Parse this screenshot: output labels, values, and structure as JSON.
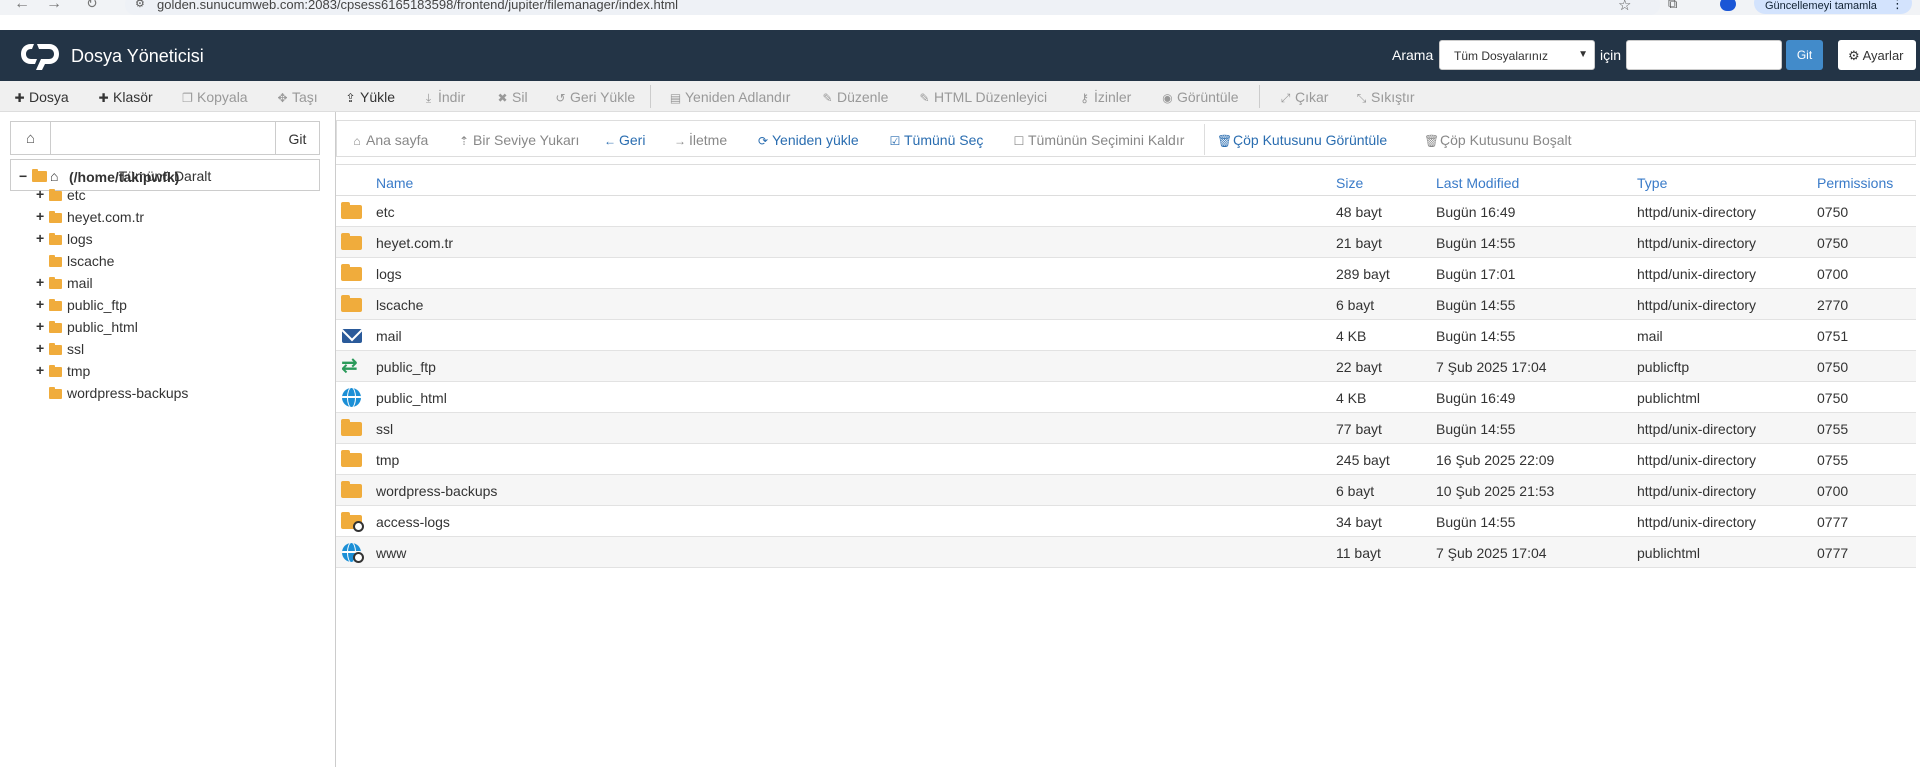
{
  "browser": {
    "url": "golden.sunucumweb.com:2083/cpsess6165183598/frontend/jupiter/filemanager/index.html",
    "update_label": "Güncellemeyi tamamla"
  },
  "header": {
    "app_title": "Dosya Yöneticisi",
    "search_label": "Arama",
    "search_scope": "Tüm Dosyalarınız",
    "icin_label": "için",
    "search_value": "",
    "go_label": "Git",
    "settings_label": "Ayarlar"
  },
  "toolbar": {
    "items": [
      {
        "label": "Dosya",
        "icon": "plus-icon",
        "glyph": "✚",
        "enabled": true
      },
      {
        "label": "Klasör",
        "icon": "plus-icon",
        "glyph": "✚",
        "enabled": true
      },
      {
        "label": "Kopyala",
        "icon": "copy-icon",
        "glyph": "❐",
        "enabled": false
      },
      {
        "label": "Taşı",
        "icon": "move-icon",
        "glyph": "✥",
        "enabled": false
      },
      {
        "label": "Yükle",
        "icon": "upload-icon",
        "glyph": "⇪",
        "enabled": true
      },
      {
        "label": "İndir",
        "icon": "download-icon",
        "glyph": "⤓",
        "enabled": false
      },
      {
        "label": "Sil",
        "icon": "delete-icon",
        "glyph": "✖",
        "enabled": false
      },
      {
        "label": "Geri Yükle",
        "icon": "restore-icon",
        "glyph": "↺",
        "enabled": false
      },
      {
        "label": "Yeniden Adlandır",
        "icon": "rename-icon",
        "glyph": "▤",
        "enabled": false
      },
      {
        "label": "Düzenle",
        "icon": "edit-icon",
        "glyph": "✎",
        "enabled": false
      },
      {
        "label": "HTML Düzenleyici",
        "icon": "html-edit-icon",
        "glyph": "✎",
        "enabled": false
      },
      {
        "label": "İzinler",
        "icon": "key-icon",
        "glyph": "⚷",
        "enabled": false
      },
      {
        "label": "Görüntüle",
        "icon": "eye-icon",
        "glyph": "◉",
        "enabled": false
      },
      {
        "label": "Çıkar",
        "icon": "extract-icon",
        "glyph": "⤢",
        "enabled": false
      },
      {
        "label": "Sıkıştır",
        "icon": "compress-icon",
        "glyph": "⤡",
        "enabled": false
      }
    ]
  },
  "leftpanel": {
    "path_value": "",
    "go_label": "Git",
    "collapse_label": "Tümünü Daralt",
    "root_label": "(/home/takipwfk)",
    "tree": [
      {
        "label": "etc",
        "expandable": true
      },
      {
        "label": "heyet.com.tr",
        "expandable": true
      },
      {
        "label": "logs",
        "expandable": true
      },
      {
        "label": "lscache",
        "expandable": false
      },
      {
        "label": "mail",
        "expandable": true
      },
      {
        "label": "public_ftp",
        "expandable": true
      },
      {
        "label": "public_html",
        "expandable": true
      },
      {
        "label": "ssl",
        "expandable": true
      },
      {
        "label": "tmp",
        "expandable": true
      },
      {
        "label": "wordpress-backups",
        "expandable": false
      }
    ]
  },
  "subbar": {
    "items": [
      {
        "label": "Ana sayfa",
        "icon": "home-icon",
        "glyph": "⌂",
        "state": "dis"
      },
      {
        "label": "Bir Seviye Yukarı",
        "icon": "level-up-icon",
        "glyph": "⇡",
        "state": "dis"
      },
      {
        "label": "Geri",
        "icon": "back-arrow-icon",
        "glyph": "←",
        "state": "act"
      },
      {
        "label": "İletme",
        "icon": "forward-arrow-icon",
        "glyph": "→",
        "state": "dis"
      },
      {
        "label": "Yeniden yükle",
        "icon": "reload-icon",
        "glyph": "⟳",
        "state": "act"
      },
      {
        "label": "Tümünü Seç",
        "icon": "checkbox-checked-icon",
        "glyph": "☑",
        "state": "act"
      },
      {
        "label": "Tümünün Seçimini Kaldır",
        "icon": "checkbox-empty-icon",
        "glyph": "☐",
        "state": "dis"
      },
      {
        "label": "Çöp Kutusunu Görüntüle",
        "icon": "trash-icon",
        "glyph": "🗑",
        "state": "act"
      },
      {
        "label": "Çöp Kutusunu Boşalt",
        "icon": "trash-icon",
        "glyph": "🗑",
        "state": "dis"
      }
    ]
  },
  "table": {
    "columns": [
      "Name",
      "Size",
      "Last Modified",
      "Type",
      "Permissions"
    ],
    "rows": [
      {
        "icon": "folder",
        "name": "etc",
        "size": "48 bayt",
        "modified": "Bugün 16:49",
        "type": "httpd/unix-directory",
        "perms": "0750"
      },
      {
        "icon": "folder",
        "name": "heyet.com.tr",
        "size": "21 bayt",
        "modified": "Bugün 14:55",
        "type": "httpd/unix-directory",
        "perms": "0750"
      },
      {
        "icon": "folder",
        "name": "logs",
        "size": "289 bayt",
        "modified": "Bugün 17:01",
        "type": "httpd/unix-directory",
        "perms": "0700"
      },
      {
        "icon": "folder",
        "name": "lscache",
        "size": "6 bayt",
        "modified": "Bugün 14:55",
        "type": "httpd/unix-directory",
        "perms": "2770"
      },
      {
        "icon": "mail",
        "name": "mail",
        "size": "4 KB",
        "modified": "Bugün 14:55",
        "type": "mail",
        "perms": "0751"
      },
      {
        "icon": "ftp",
        "name": "public_ftp",
        "size": "22 bayt",
        "modified": "7 Şub 2025 17:04",
        "type": "publicftp",
        "perms": "0750"
      },
      {
        "icon": "globe",
        "name": "public_html",
        "size": "4 KB",
        "modified": "Bugün 16:49",
        "type": "publichtml",
        "perms": "0750"
      },
      {
        "icon": "folder",
        "name": "ssl",
        "size": "77 bayt",
        "modified": "Bugün 14:55",
        "type": "httpd/unix-directory",
        "perms": "0755"
      },
      {
        "icon": "folder",
        "name": "tmp",
        "size": "245 bayt",
        "modified": "16 Şub 2025 22:09",
        "type": "httpd/unix-directory",
        "perms": "0755"
      },
      {
        "icon": "folder",
        "name": "wordpress-backups",
        "size": "6 bayt",
        "modified": "10 Şub 2025 21:53",
        "type": "httpd/unix-directory",
        "perms": "0700"
      },
      {
        "icon": "folder-link",
        "name": "access-logs",
        "size": "34 bayt",
        "modified": "Bugün 14:55",
        "type": "httpd/unix-directory",
        "perms": "0777"
      },
      {
        "icon": "globe-link",
        "name": "www",
        "size": "11 bayt",
        "modified": "7 Şub 2025 17:04",
        "type": "publichtml",
        "perms": "0777"
      }
    ]
  }
}
